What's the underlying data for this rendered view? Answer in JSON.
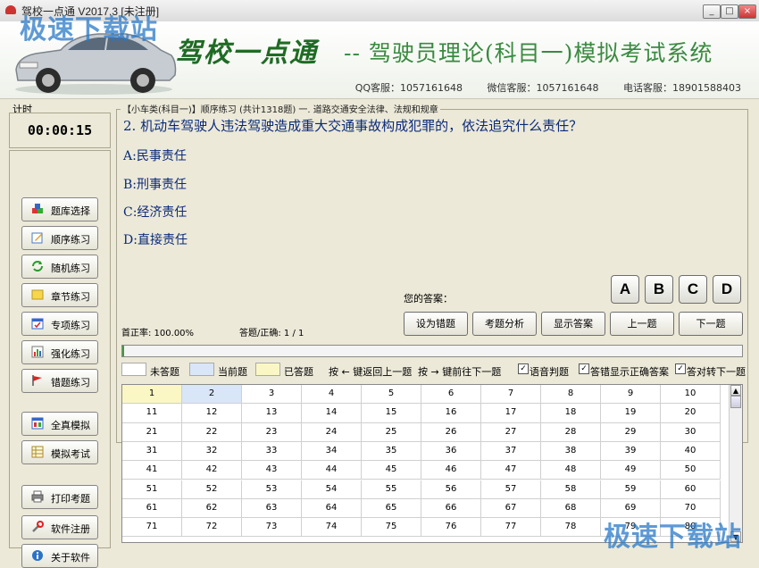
{
  "window": {
    "title": "驾校一点通 V2017.3 [未注册]"
  },
  "banner": {
    "app_title": "驾校一点通",
    "subtitle": "-- 驾驶员理论(科目一)模拟考试系统",
    "contacts": [
      "QQ客服：1057161648",
      "微信客服：1057161648",
      "电话客服：18901588403"
    ]
  },
  "watermark": "极速下载站",
  "timer": {
    "label": "计时",
    "value": "00:00:15"
  },
  "nav": [
    {
      "label": "题库选择",
      "icon": "cubes-icon"
    },
    {
      "label": "顺序练习",
      "icon": "pencil-icon"
    },
    {
      "label": "随机练习",
      "icon": "refresh-icon"
    },
    {
      "label": "章节练习",
      "icon": "note-icon"
    },
    {
      "label": "专项练习",
      "icon": "calendar-check-icon"
    },
    {
      "label": "强化练习",
      "icon": "chart-icon"
    },
    {
      "label": "错题练习",
      "icon": "flag-icon"
    },
    {
      "label": "全真模拟",
      "icon": "window-icon"
    },
    {
      "label": "模拟考试",
      "icon": "table-icon"
    },
    {
      "label": "打印考题",
      "icon": "printer-icon"
    },
    {
      "label": "软件注册",
      "icon": "wrench-icon"
    },
    {
      "label": "关于软件",
      "icon": "info-icon"
    }
  ],
  "question": {
    "header": "【小车类(科目一)】顺序练习 (共计1318题) 一. 道路交通安全法律、法规和规章",
    "text": "2. 机动车驾驶人违法驾驶造成重大交通事故构成犯罪的，依法追究什么责任？",
    "options": [
      "A:民事责任",
      "B:刑事责任",
      "C:经济责任",
      "D:直接责任"
    ]
  },
  "answer": {
    "label": "您的答案：",
    "choices": [
      "A",
      "B",
      "C",
      "D"
    ]
  },
  "stats": {
    "accuracy": "首正率: 100.00%",
    "progress": "答题/正确: 1 / 1"
  },
  "actions": [
    "设为错题",
    "考题分析",
    "显示答案",
    "上一题",
    "下一题"
  ],
  "legend": {
    "unanswered": "未答题",
    "current": "当前题",
    "answered": "已答题",
    "hint_prev": "按 ← 键返回上一题",
    "hint_next": "按 → 键前往下一题",
    "options": [
      "语音判题",
      "答错显示正确答案",
      "答对转下一题"
    ]
  },
  "colors": {
    "current": "#d9e6f7",
    "answered": "#fbf7c5",
    "unanswered": "#ffffff",
    "checked": "#000000"
  },
  "grid_numbers": [
    1,
    2,
    3,
    4,
    5,
    6,
    7,
    8,
    9,
    10,
    11,
    12,
    13,
    14,
    15,
    16,
    17,
    18,
    19,
    20,
    21,
    22,
    23,
    24,
    25,
    26,
    27,
    28,
    29,
    30,
    31,
    32,
    33,
    34,
    35,
    36,
    37,
    38,
    39,
    40,
    41,
    42,
    43,
    44,
    45,
    46,
    47,
    48,
    49,
    50,
    51,
    52,
    53,
    54,
    55,
    56,
    57,
    58,
    59,
    60,
    61,
    62,
    63,
    64,
    65,
    66,
    67,
    68,
    69,
    70,
    71,
    72,
    73,
    74,
    75,
    76,
    77,
    78,
    79,
    80
  ]
}
